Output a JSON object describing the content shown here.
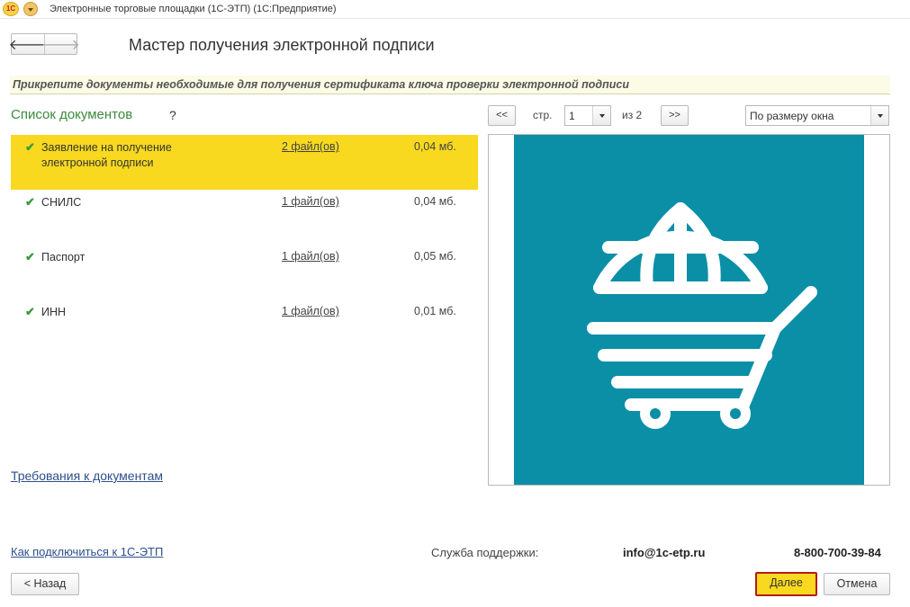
{
  "window": {
    "logo_text": "1С",
    "title": "Электронные торговые площадки (1С-ЭТП)  (1С:Предприятие)"
  },
  "nav": {
    "back_icon": "arrow-left-icon",
    "forward_icon": "arrow-right-icon",
    "back_glyph": "🡐",
    "forward_glyph": "🡒"
  },
  "page": {
    "title": "Мастер получения электронной подписи",
    "info_banner": "Прикрепите документы необходимые для получения сертификата ключа проверки электронной подписи"
  },
  "documents": {
    "title": "Список документов",
    "help": "?",
    "items": [
      {
        "name": "Заявление на получение электронной подписи",
        "files": "2 файл(ов)",
        "size": "0,04 мб.",
        "selected": true
      },
      {
        "name": "СНИЛС",
        "files": "1 файл(ов)",
        "size": "0,04 мб.",
        "selected": false
      },
      {
        "name": "Паспорт",
        "files": "1 файл(ов)",
        "size": "0,05 мб.",
        "selected": false
      },
      {
        "name": "ИНН",
        "files": "1 файл(ов)",
        "size": "0,01 мб.",
        "selected": false
      }
    ],
    "check_glyph": "✔",
    "requirements_link": "Требования к документам"
  },
  "viewer": {
    "prev_label": "<<",
    "page_label": "стр.",
    "page_value": "1",
    "of_label": "из 2",
    "next_label": ">>",
    "zoom_value": "По размеру окна",
    "preview_icon": "globe-shopping-cart-icon",
    "preview_bg": "#0a8fa7"
  },
  "footer": {
    "connect_link": "Как подключиться к 1С-ЭТП",
    "support_label": "Служба поддержки:",
    "support_email": "info@1c-etp.ru",
    "support_phone": "8-800-700-39-84",
    "back_button": "< Назад",
    "next_button": "Далее",
    "cancel_button": "Отмена"
  }
}
